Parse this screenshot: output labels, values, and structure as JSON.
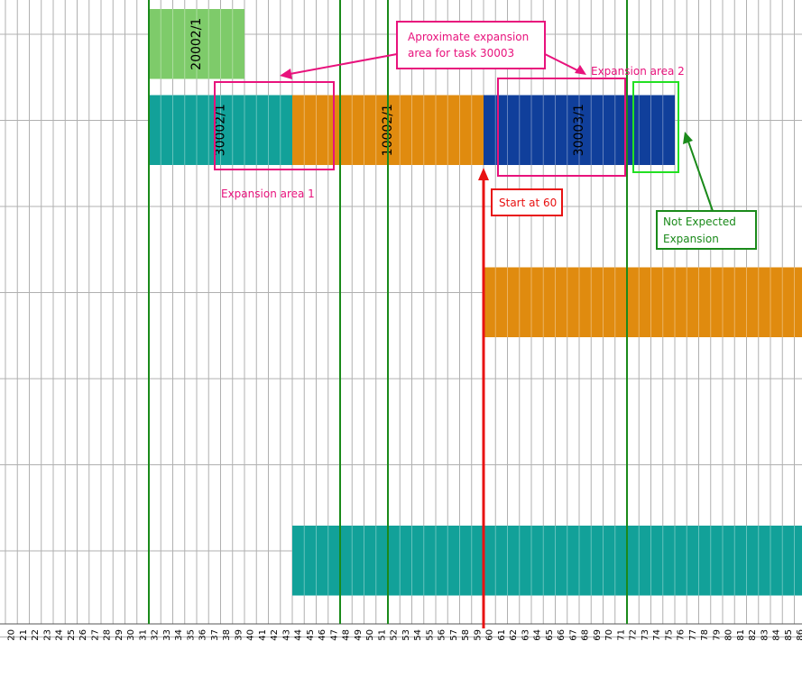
{
  "axis": {
    "start_tick": 20,
    "end_tick": 87
  },
  "tasks": [
    {
      "id": "task-20002",
      "label": "20002/1",
      "start": 32,
      "end": 40,
      "row": 0,
      "color": "#7ecb6a"
    },
    {
      "id": "task-30002",
      "label": "30002/1",
      "start": 32,
      "end": 44,
      "row": 1,
      "color": "#12a199"
    },
    {
      "id": "task-10002",
      "label": "10002/1",
      "start": 44,
      "end": 60,
      "row": 1,
      "color": "#e08b0f"
    },
    {
      "id": "task-30003",
      "label": "30003/1",
      "start": 60,
      "end": 76,
      "row": 1,
      "color": "#103f9b"
    },
    {
      "id": "task-orange-row3",
      "label": "",
      "start": 60,
      "end": 87,
      "row": 3,
      "color": "#e08b0f"
    },
    {
      "id": "task-teal-row6",
      "label": "",
      "start": 44,
      "end": 87,
      "row": 6,
      "color": "#12a199"
    }
  ],
  "milestones": [
    32,
    48,
    52,
    72
  ],
  "annotations": {
    "approx_expansion": {
      "line1": "Aproximate expansion",
      "line2": "area for task 30003"
    },
    "expansion_area_1": "Expansion area 1",
    "expansion_area_2": "Expansion area 2",
    "start_at": "Start at 60",
    "not_expected": {
      "line1": "Not Expected",
      "line2": "Expansion"
    }
  },
  "colors": {
    "grid": "#b0b0b0",
    "milestone": "#1a8a1a",
    "annotation_magenta": "#e8127c",
    "annotation_red": "#e81212",
    "annotation_green": "#1a8a1a",
    "annotation_lime": "#22e022"
  }
}
